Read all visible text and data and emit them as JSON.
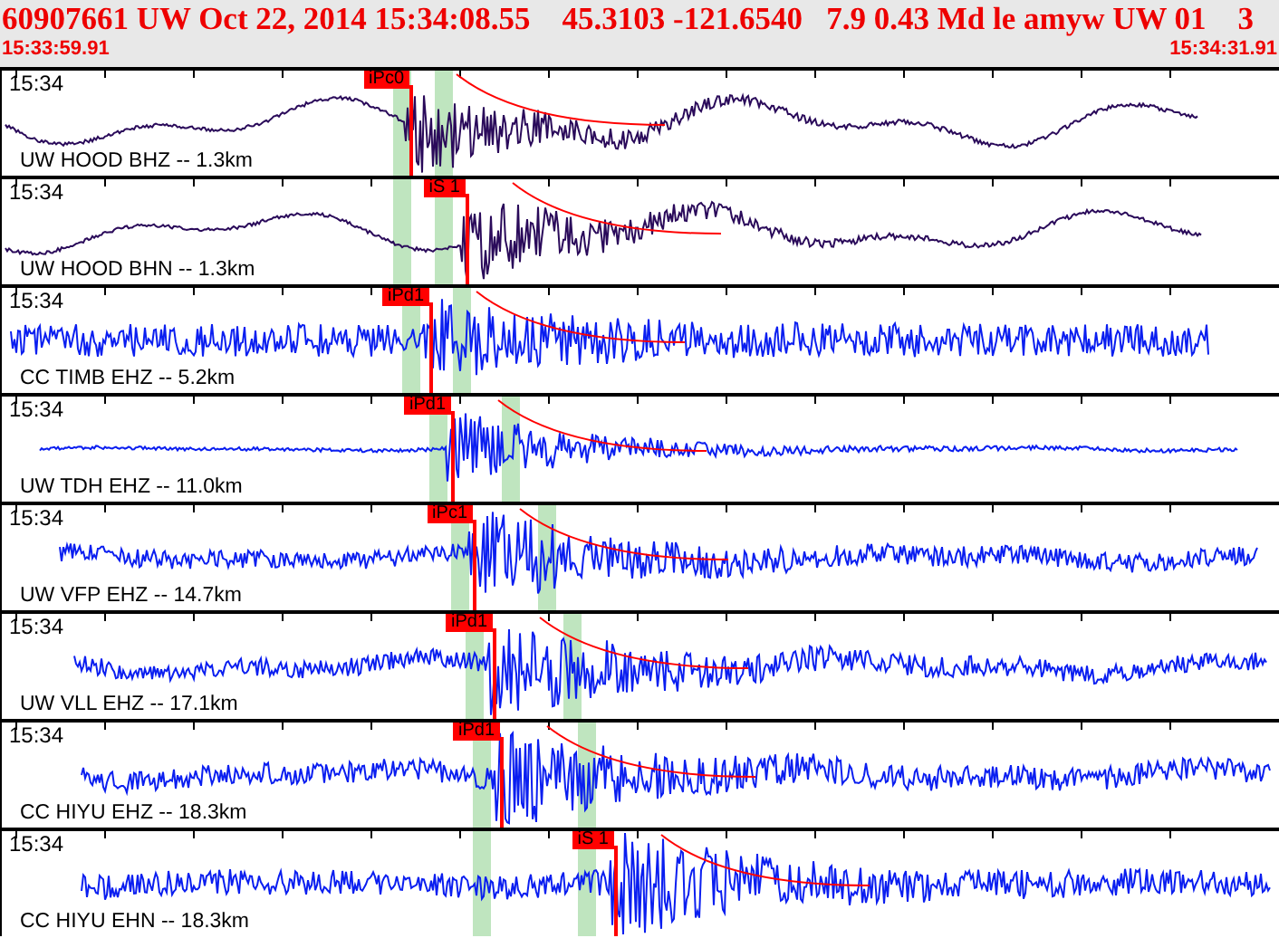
{
  "header": {
    "title": "60907661 UW Oct 22, 2014 15:34:08.55    45.3103 -121.6540   7.9 0.43 Md le amyw UW 01    3",
    "start_time": "15:33:59.91",
    "end_time": "15:34:31.91"
  },
  "traces": [
    {
      "time": "15:34",
      "label": "UW HOOD BHZ -- 1.3km",
      "color": "#2a0a5a",
      "pick": "iPc0"
    },
    {
      "time": "15:34",
      "label": "UW HOOD BHN -- 1.3km",
      "color": "#2a0a5a",
      "pick": "iS 1"
    },
    {
      "time": "15:34",
      "label": "CC TIMB EHZ -- 5.2km",
      "color": "#0a1ef0",
      "pick": "iPd1"
    },
    {
      "time": "15:34",
      "label": "UW TDH EHZ -- 11.0km",
      "color": "#0a1ef0",
      "pick": "iPd1"
    },
    {
      "time": "15:34",
      "label": "UW VFP EHZ -- 14.7km",
      "color": "#0a1ef0",
      "pick": "iPc1"
    },
    {
      "time": "15:34",
      "label": "UW VLL EHZ -- 17.1km",
      "color": "#0a1ef0",
      "pick": "iPd1"
    },
    {
      "time": "15:34",
      "label": "CC HIYU EHZ -- 18.3km",
      "color": "#0a1ef0",
      "pick": "iPd1"
    },
    {
      "time": "15:34",
      "label": "CC HIYU EHN -- 18.3km",
      "color": "#0a1ef0",
      "pick": "iS 1"
    }
  ]
}
